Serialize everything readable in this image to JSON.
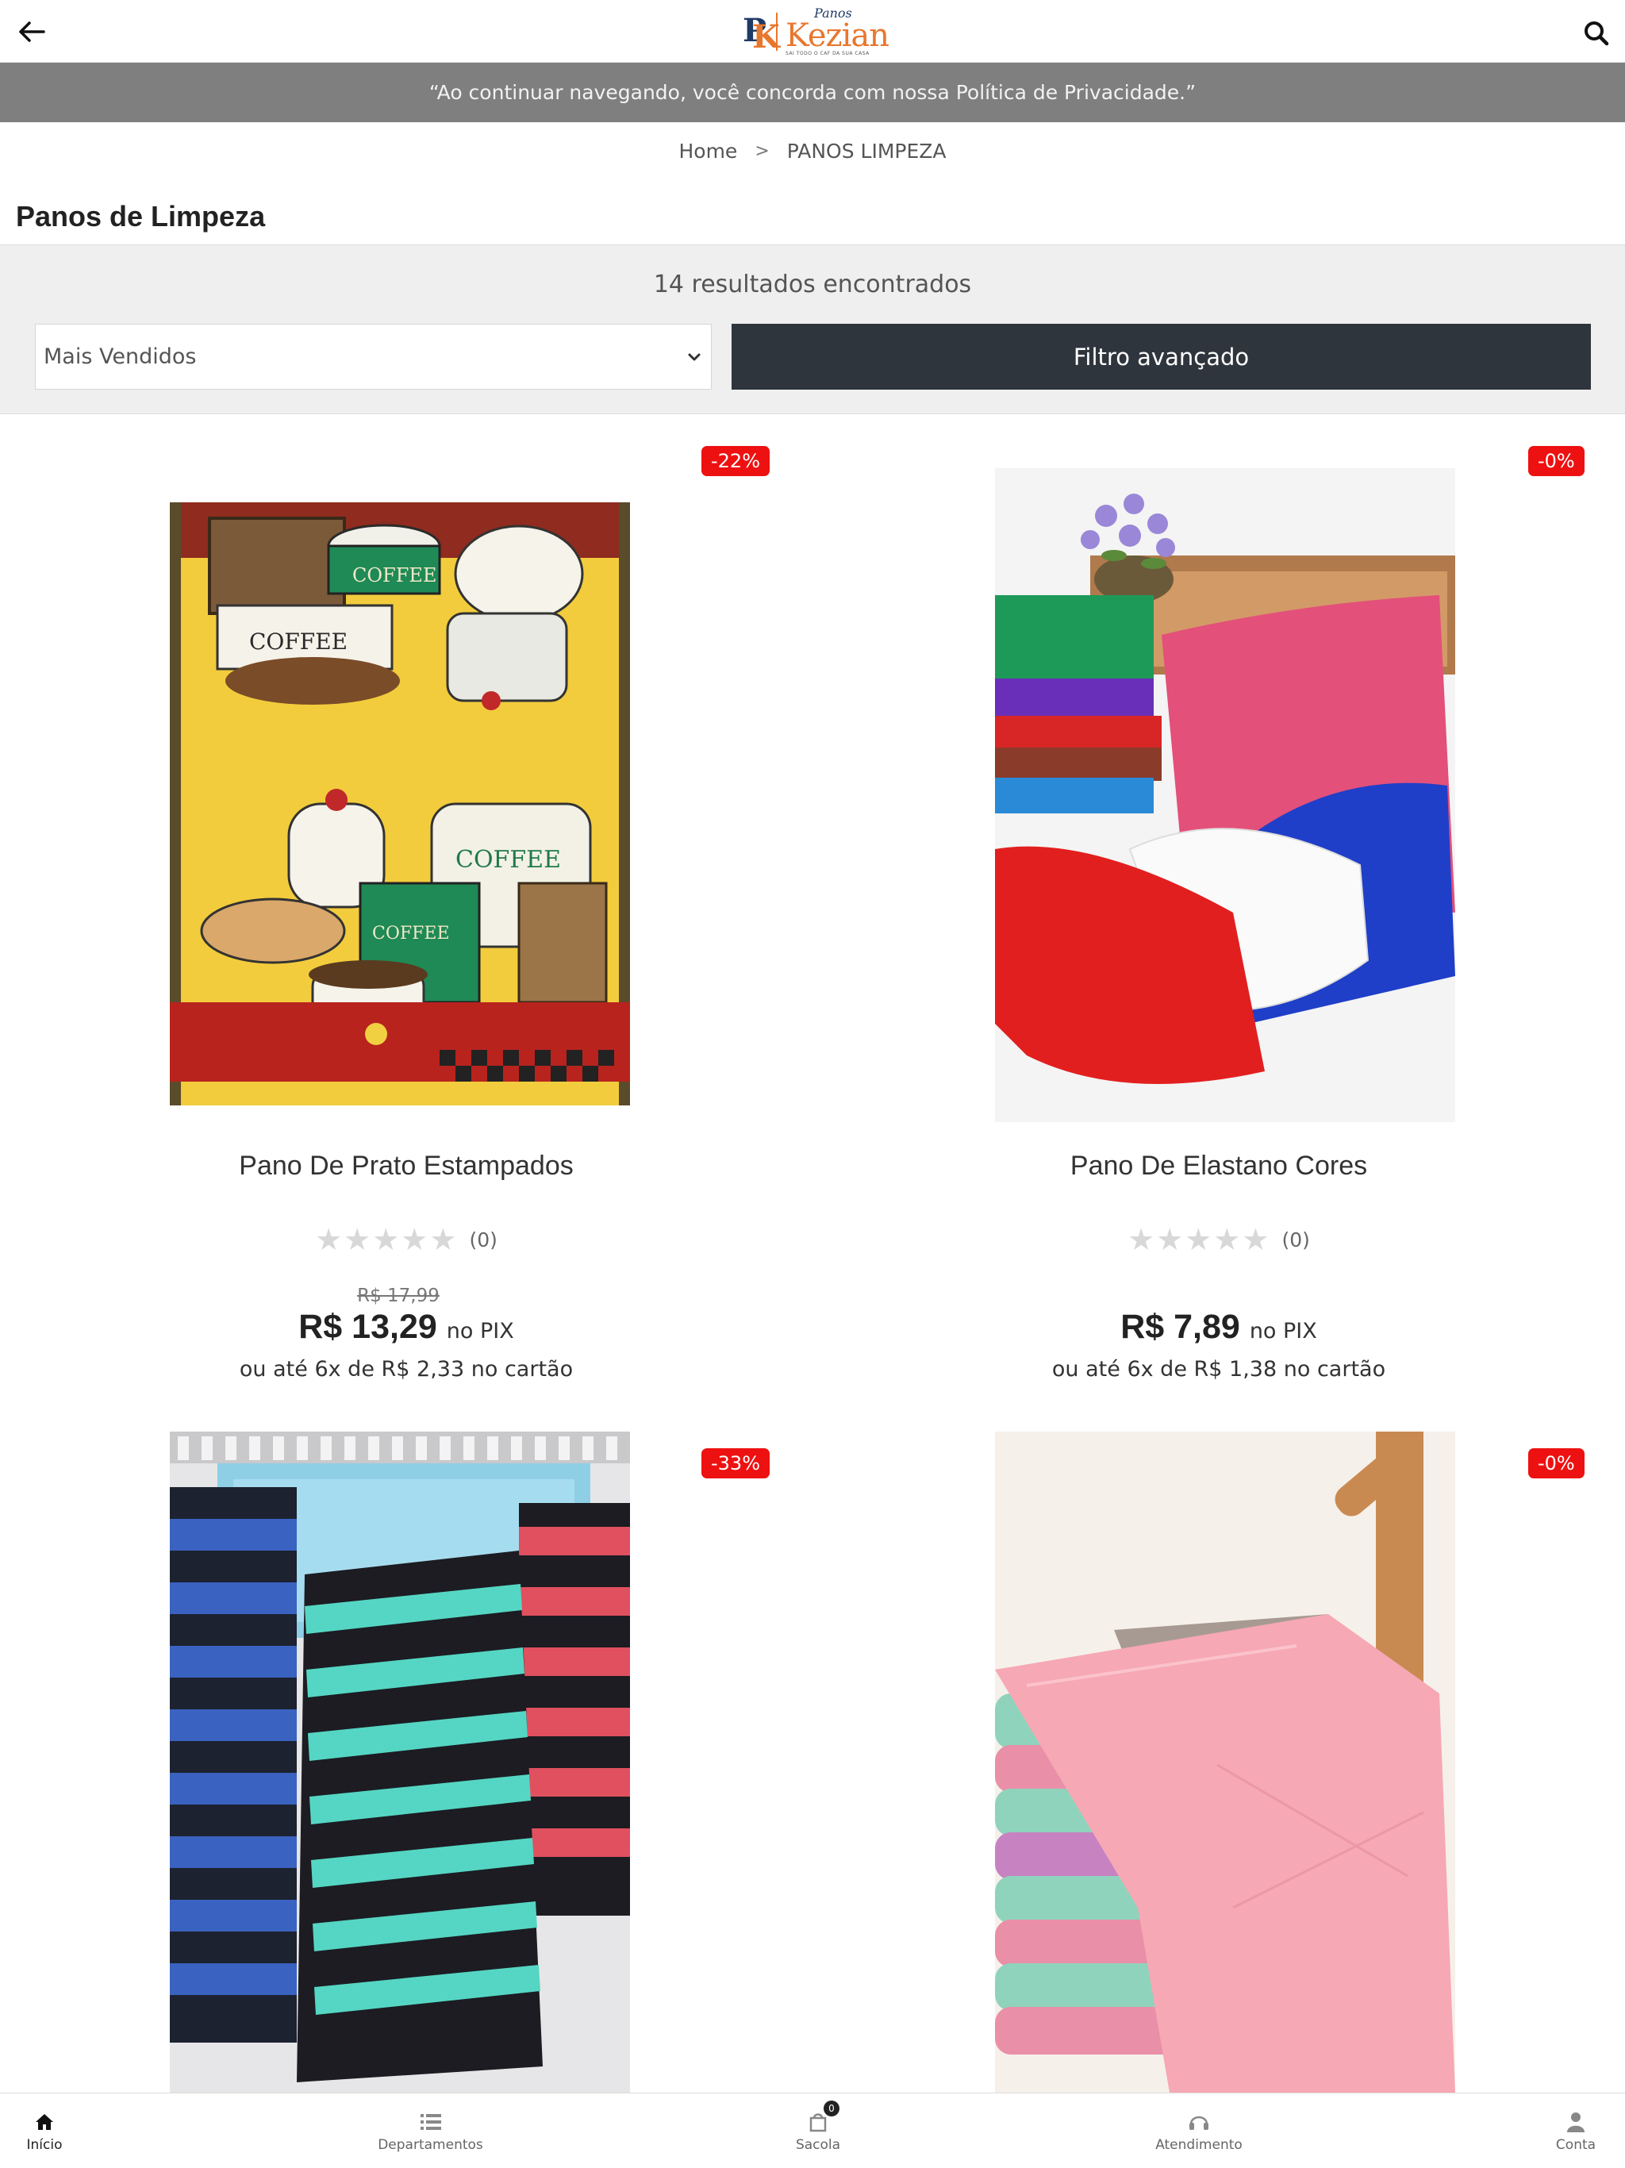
{
  "header": {
    "logo_mark_p": "P",
    "logo_mark_k": "K",
    "logo_panos": "Panos",
    "logo_brand": "Kezian",
    "logo_tagline": "SAI TODO O CAF DA SUA CASA",
    "icons": {
      "back": "arrow-left-icon",
      "search": "search-icon"
    }
  },
  "privacy_notice": "“Ao continuar navegando, você concorda com nossa Política de Privacidade.”",
  "breadcrumb": {
    "home": "Home",
    "separator": ">",
    "current": "PANOS LIMPEZA"
  },
  "page_title": "Panos de Limpeza",
  "filters": {
    "results_text": "14 resultados encontrados",
    "sort_selected": "Mais Vendidos",
    "advanced_filter_label": "Filtro avançado"
  },
  "products": [
    {
      "discount": "-22%",
      "name": "Pano De Prato Estampados",
      "stars": "★★★★★",
      "rating_count": "(0)",
      "old_price": "R$ 17,99",
      "price": "R$ 13,29",
      "price_suffix": "no PIX",
      "installments": "ou até 6x de R$ 2,33 no cartão",
      "image_label": "COFFEE"
    },
    {
      "discount": "-0%",
      "name": "Pano De Elastano Cores",
      "stars": "★★★★★",
      "rating_count": "(0)",
      "old_price": "",
      "price": "R$ 7,89",
      "price_suffix": "no PIX",
      "installments": "ou até 6x de R$ 1,38 no cartão"
    },
    {
      "discount": "-33%"
    },
    {
      "discount": "-0%"
    }
  ],
  "bottom_nav": [
    {
      "label": "Início",
      "icon": "home-icon",
      "active": true
    },
    {
      "label": "Departamentos",
      "icon": "list-icon"
    },
    {
      "label": "Sacola",
      "icon": "bag-icon",
      "badge": "0"
    },
    {
      "label": "Atendimento",
      "icon": "headset-icon"
    },
    {
      "label": "Conta",
      "icon": "user-icon"
    }
  ],
  "colors": {
    "privacy_bar": "#7f7f7f",
    "filter_button": "#2f353d",
    "discount_badge": "#ee1111",
    "brand_orange": "#e8772e",
    "brand_navy": "#1f3a66"
  }
}
